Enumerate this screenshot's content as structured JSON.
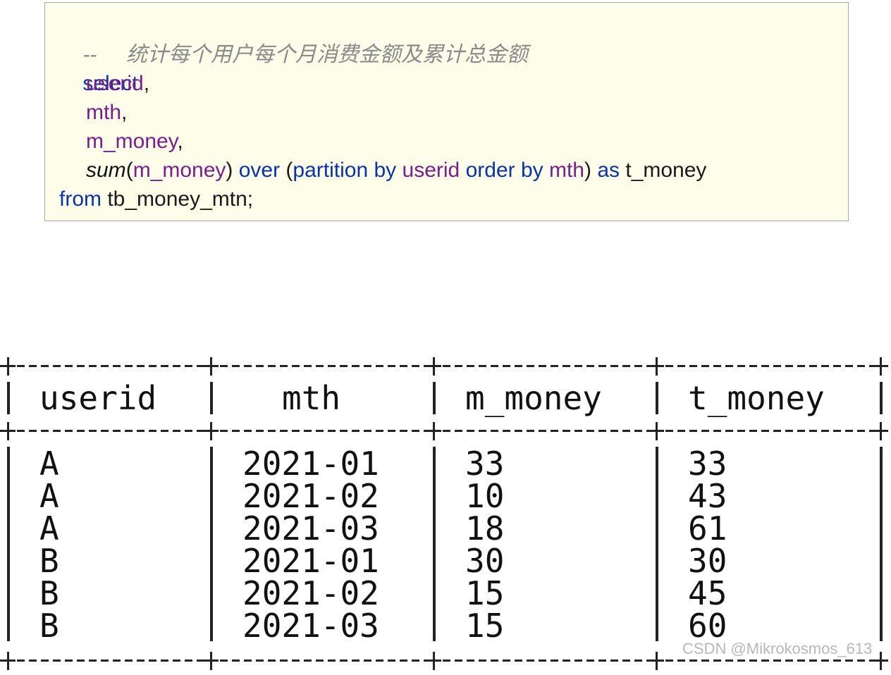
{
  "code": {
    "comment": "--     统计每个用户每个月消费金额及累计总金额",
    "select_kw": "select",
    "col1": "userid",
    "col2": "mth",
    "col3": "m_money",
    "sum_fn": "sum",
    "sum_arg": "m_money",
    "over_kw": "over",
    "partition_kw": "partition by",
    "partition_col": "userid",
    "order_kw": "order by",
    "order_col": "mth",
    "as_kw": "as",
    "alias": "t_money",
    "from_kw": "from",
    "table_name": "tb_money_mtn;"
  },
  "result": {
    "headers": [
      "userid",
      "mth",
      "m_money",
      "t_money"
    ],
    "rows": [
      [
        "A",
        "2021-01",
        "33",
        "33"
      ],
      [
        "A",
        "2021-02",
        "10",
        "43"
      ],
      [
        "A",
        "2021-03",
        "18",
        "61"
      ],
      [
        "B",
        "2021-01",
        "30",
        "30"
      ],
      [
        "B",
        "2021-02",
        "15",
        "45"
      ],
      [
        "B",
        "2021-03",
        "15",
        "60"
      ]
    ]
  },
  "watermark": "CSDN @Mikrokosmos_613"
}
